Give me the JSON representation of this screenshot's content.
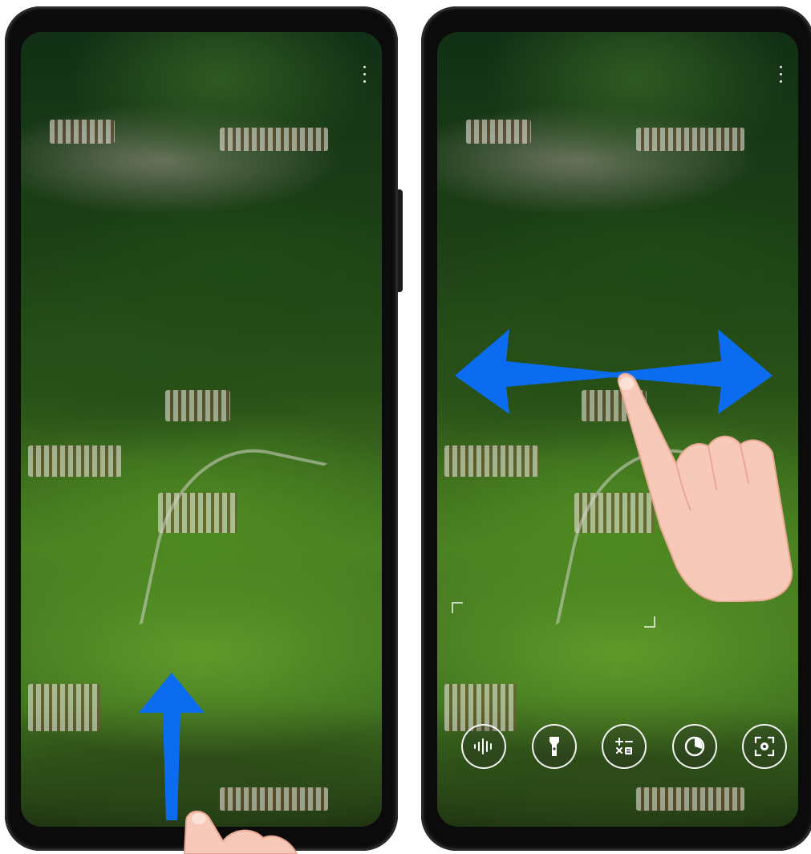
{
  "left_panel": {
    "gesture": "swipe-up",
    "menu_icon": "more-vertical-icon"
  },
  "right_panel": {
    "gesture": "swipe-left-right",
    "menu_icon": "more-vertical-icon",
    "toolbar": [
      {
        "icon": "voice-waveform-icon"
      },
      {
        "icon": "flashlight-icon"
      },
      {
        "icon": "calculator-icon"
      },
      {
        "icon": "timer-icon"
      },
      {
        "icon": "scan-camera-icon"
      }
    ]
  },
  "colors": {
    "arrow": "#0b6cf0",
    "hand": "#f7c9b8",
    "bezel": "#0b0b0c"
  }
}
